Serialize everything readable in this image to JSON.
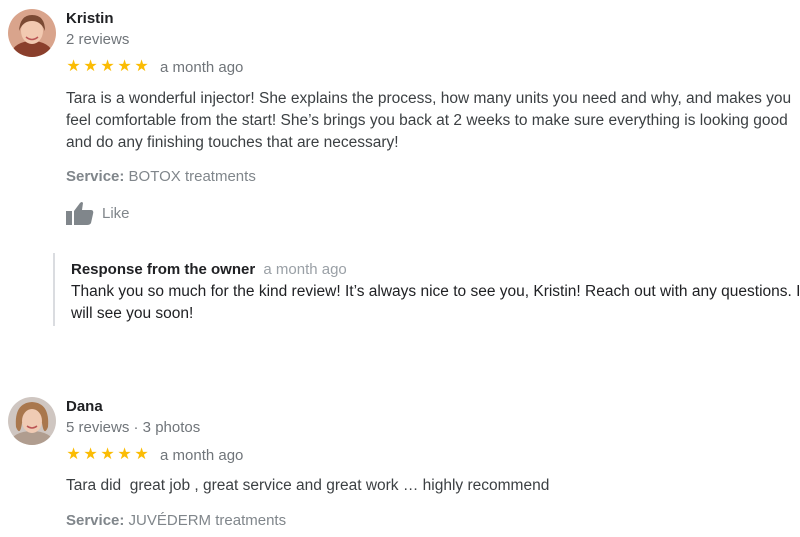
{
  "reviews": [
    {
      "name": "Kristin",
      "meta": "2 reviews",
      "stars": 5,
      "date": "a month ago",
      "text": "Tara is a wonderful injector! She explains the process, how many units you need and why, and makes you feel comfortable from the start! She’s brings you back at 2 weeks to make sure everything is looking good and do any finishing touches that are necessary!",
      "service_label": "Service:",
      "service_value": "BOTOX treatments",
      "like_label": "Like",
      "owner_response": {
        "title": "Response from the owner",
        "date": "a month ago",
        "text": "Thank you so much for the kind review! It’s always nice to see you, Kristin! Reach out with any questions. I will see you soon!"
      }
    },
    {
      "name": "Dana",
      "meta": "5 reviews · 3 photos",
      "stars": 5,
      "date": "a month ago",
      "text": "Tara did  great job , great service and great work … highly recommend",
      "service_label": "Service:",
      "service_value": "JUVÉDERM treatments"
    }
  ],
  "colors": {
    "star": "#fbbc04",
    "muted": "#80868b",
    "divider": "#dadce0"
  },
  "icons": {
    "avatar": "profile-photo",
    "like": "thumbs-up-icon",
    "star": "star-icon"
  }
}
